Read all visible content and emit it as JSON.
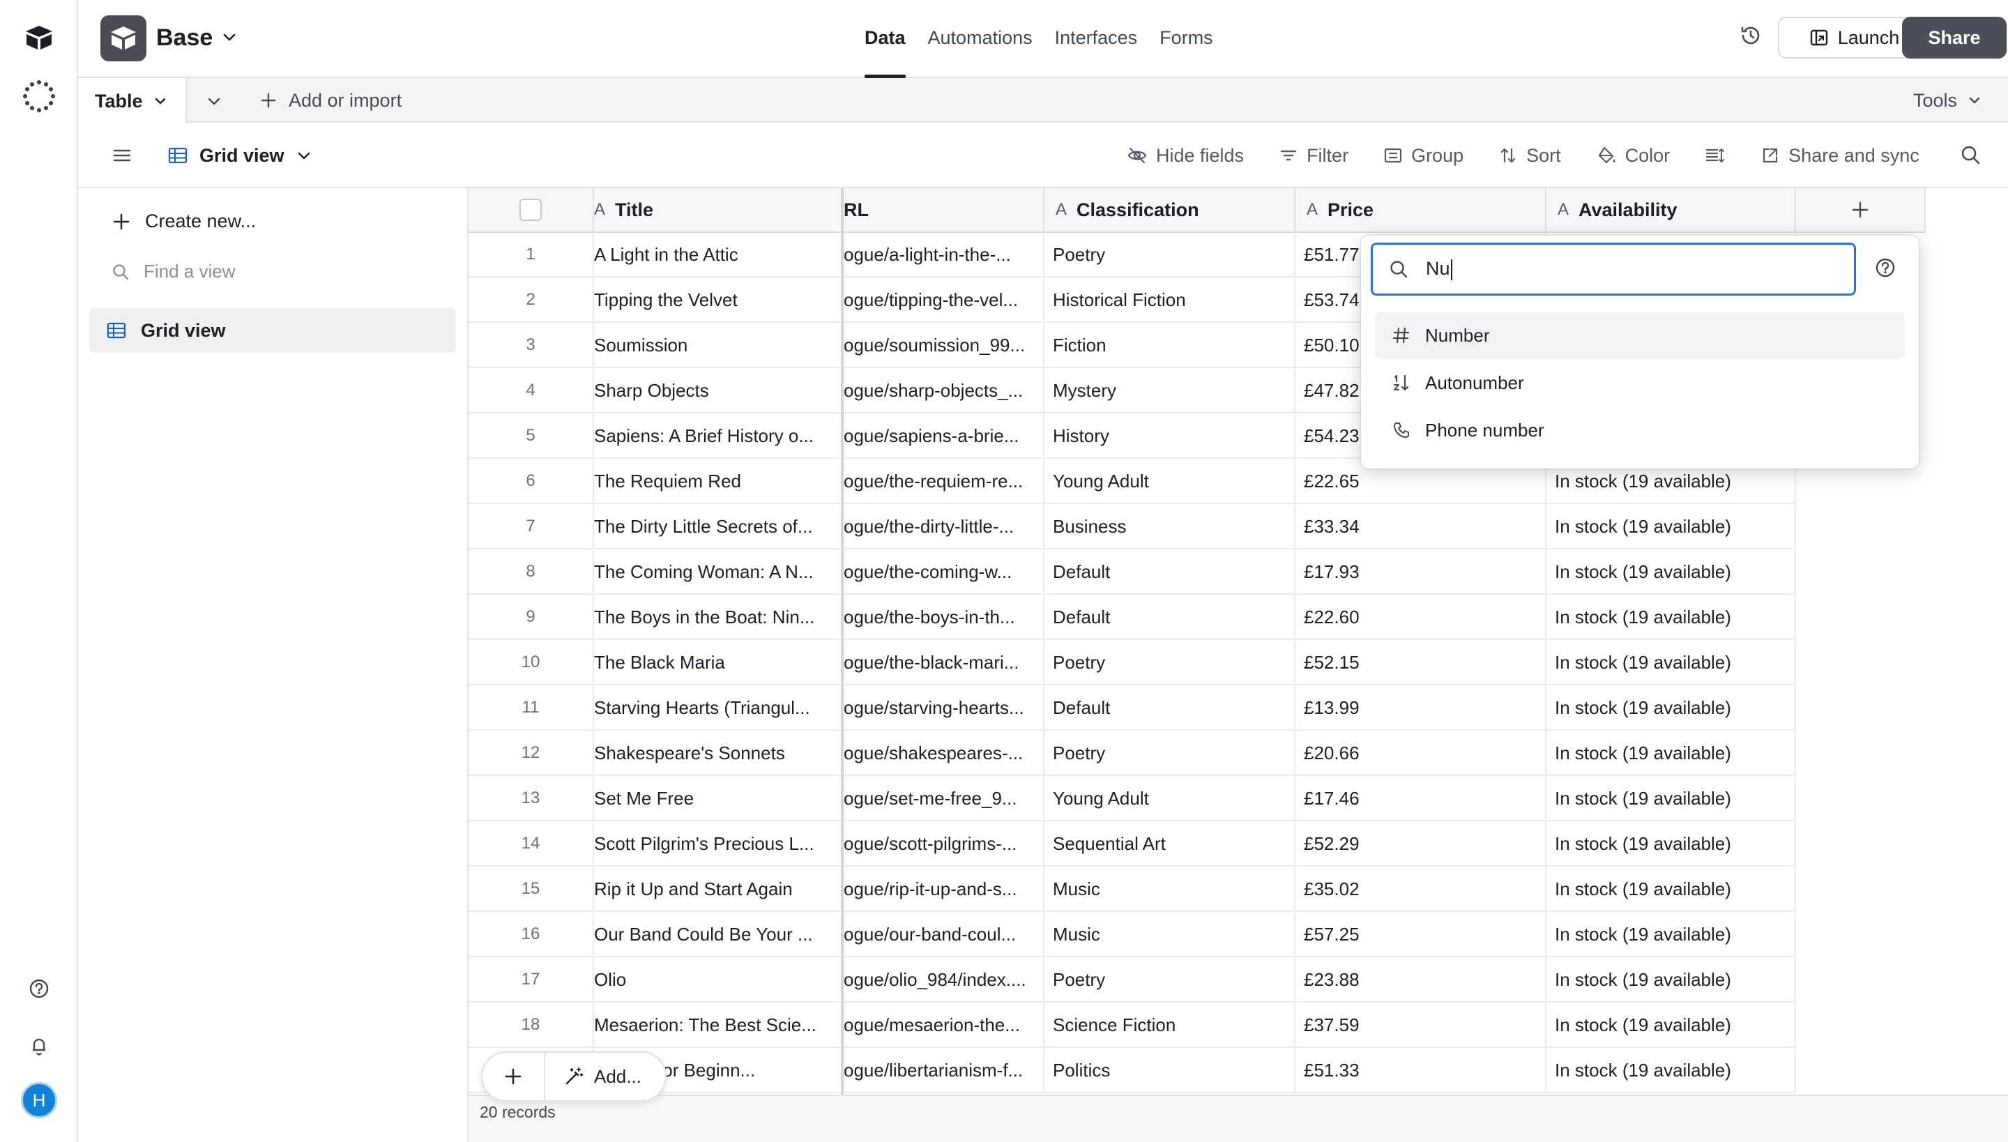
{
  "app": {
    "base_name": "Base",
    "nav_tabs": [
      "Data",
      "Automations",
      "Interfaces",
      "Forms"
    ],
    "active_tab": "Data",
    "launch_label": "Launch",
    "share_label": "Share",
    "avatar_initial": "H"
  },
  "tablebar": {
    "table_label": "Table",
    "add_import_label": "Add or import",
    "tools_label": "Tools"
  },
  "viewbar": {
    "view_name": "Grid view",
    "hide_fields": "Hide fields",
    "filter": "Filter",
    "group": "Group",
    "sort": "Sort",
    "color": "Color",
    "share_sync": "Share and sync"
  },
  "sidebar": {
    "create_new": "Create new...",
    "find_view_placeholder": "Find a view",
    "views": [
      "Grid view"
    ]
  },
  "grid": {
    "columns": [
      "Title",
      "RL",
      "Classification",
      "Price",
      "Availability"
    ],
    "rows": [
      {
        "n": "1",
        "title": "A Light in the Attic",
        "url": "ogue/a-light-in-the-...",
        "cls": "Poetry",
        "price": "£51.77",
        "avail": ""
      },
      {
        "n": "2",
        "title": "Tipping the Velvet",
        "url": "ogue/tipping-the-vel...",
        "cls": "Historical Fiction",
        "price": "£53.74",
        "avail": ""
      },
      {
        "n": "3",
        "title": "Soumission",
        "url": "ogue/soumission_99...",
        "cls": "Fiction",
        "price": "£50.10",
        "avail": ""
      },
      {
        "n": "4",
        "title": "Sharp Objects",
        "url": "ogue/sharp-objects_...",
        "cls": "Mystery",
        "price": "£47.82",
        "avail": ""
      },
      {
        "n": "5",
        "title": "Sapiens: A Brief History o...",
        "url": "ogue/sapiens-a-brie...",
        "cls": "History",
        "price": "£54.23",
        "avail": ""
      },
      {
        "n": "6",
        "title": "The Requiem Red",
        "url": "ogue/the-requiem-re...",
        "cls": "Young Adult",
        "price": "£22.65",
        "avail": "In stock (19 available)"
      },
      {
        "n": "7",
        "title": "The Dirty Little Secrets of...",
        "url": "ogue/the-dirty-little-...",
        "cls": "Business",
        "price": "£33.34",
        "avail": "In stock (19 available)"
      },
      {
        "n": "8",
        "title": "The Coming Woman: A N...",
        "url": "ogue/the-coming-w...",
        "cls": "Default",
        "price": "£17.93",
        "avail": "In stock (19 available)"
      },
      {
        "n": "9",
        "title": "The Boys in the Boat: Nin...",
        "url": "ogue/the-boys-in-th...",
        "cls": "Default",
        "price": "£22.60",
        "avail": "In stock (19 available)"
      },
      {
        "n": "10",
        "title": "The Black Maria",
        "url": "ogue/the-black-mari...",
        "cls": "Poetry",
        "price": "£52.15",
        "avail": "In stock (19 available)"
      },
      {
        "n": "11",
        "title": "Starving Hearts (Triangul...",
        "url": "ogue/starving-hearts...",
        "cls": "Default",
        "price": "£13.99",
        "avail": "In stock (19 available)"
      },
      {
        "n": "12",
        "title": "Shakespeare's Sonnets",
        "url": "ogue/shakespeares-...",
        "cls": "Poetry",
        "price": "£20.66",
        "avail": "In stock (19 available)"
      },
      {
        "n": "13",
        "title": "Set Me Free",
        "url": "ogue/set-me-free_9...",
        "cls": "Young Adult",
        "price": "£17.46",
        "avail": "In stock (19 available)"
      },
      {
        "n": "14",
        "title": "Scott Pilgrim's Precious L...",
        "url": "ogue/scott-pilgrims-...",
        "cls": "Sequential Art",
        "price": "£52.29",
        "avail": "In stock (19 available)"
      },
      {
        "n": "15",
        "title": "Rip it Up and Start Again",
        "url": "ogue/rip-it-up-and-s...",
        "cls": "Music",
        "price": "£35.02",
        "avail": "In stock (19 available)"
      },
      {
        "n": "16",
        "title": "Our Band Could Be Your ...",
        "url": "ogue/our-band-coul...",
        "cls": "Music",
        "price": "£57.25",
        "avail": "In stock (19 available)"
      },
      {
        "n": "17",
        "title": "Olio",
        "url": "ogue/olio_984/index....",
        "cls": "Poetry",
        "price": "£23.88",
        "avail": "In stock (19 available)"
      },
      {
        "n": "18",
        "title": "Mesaerion: The Best Scie...",
        "url": "ogue/mesaerion-the...",
        "cls": "Science Fiction",
        "price": "£37.59",
        "avail": "In stock (19 available)"
      },
      {
        "n": "",
        "title": "rianism for Beginn...",
        "url": "ogue/libertarianism-f...",
        "cls": "Politics",
        "price": "£51.33",
        "avail": "In stock (19 available)"
      }
    ],
    "records_count": "20 records",
    "add_label": "Add..."
  },
  "dropdown": {
    "search_value": "Nu",
    "options": [
      {
        "label": "Number",
        "icon": "hash-icon"
      },
      {
        "label": "Autonumber",
        "icon": "autonumber-icon"
      },
      {
        "label": "Phone number",
        "icon": "phone-icon"
      }
    ],
    "accent": "#2b73d9"
  }
}
